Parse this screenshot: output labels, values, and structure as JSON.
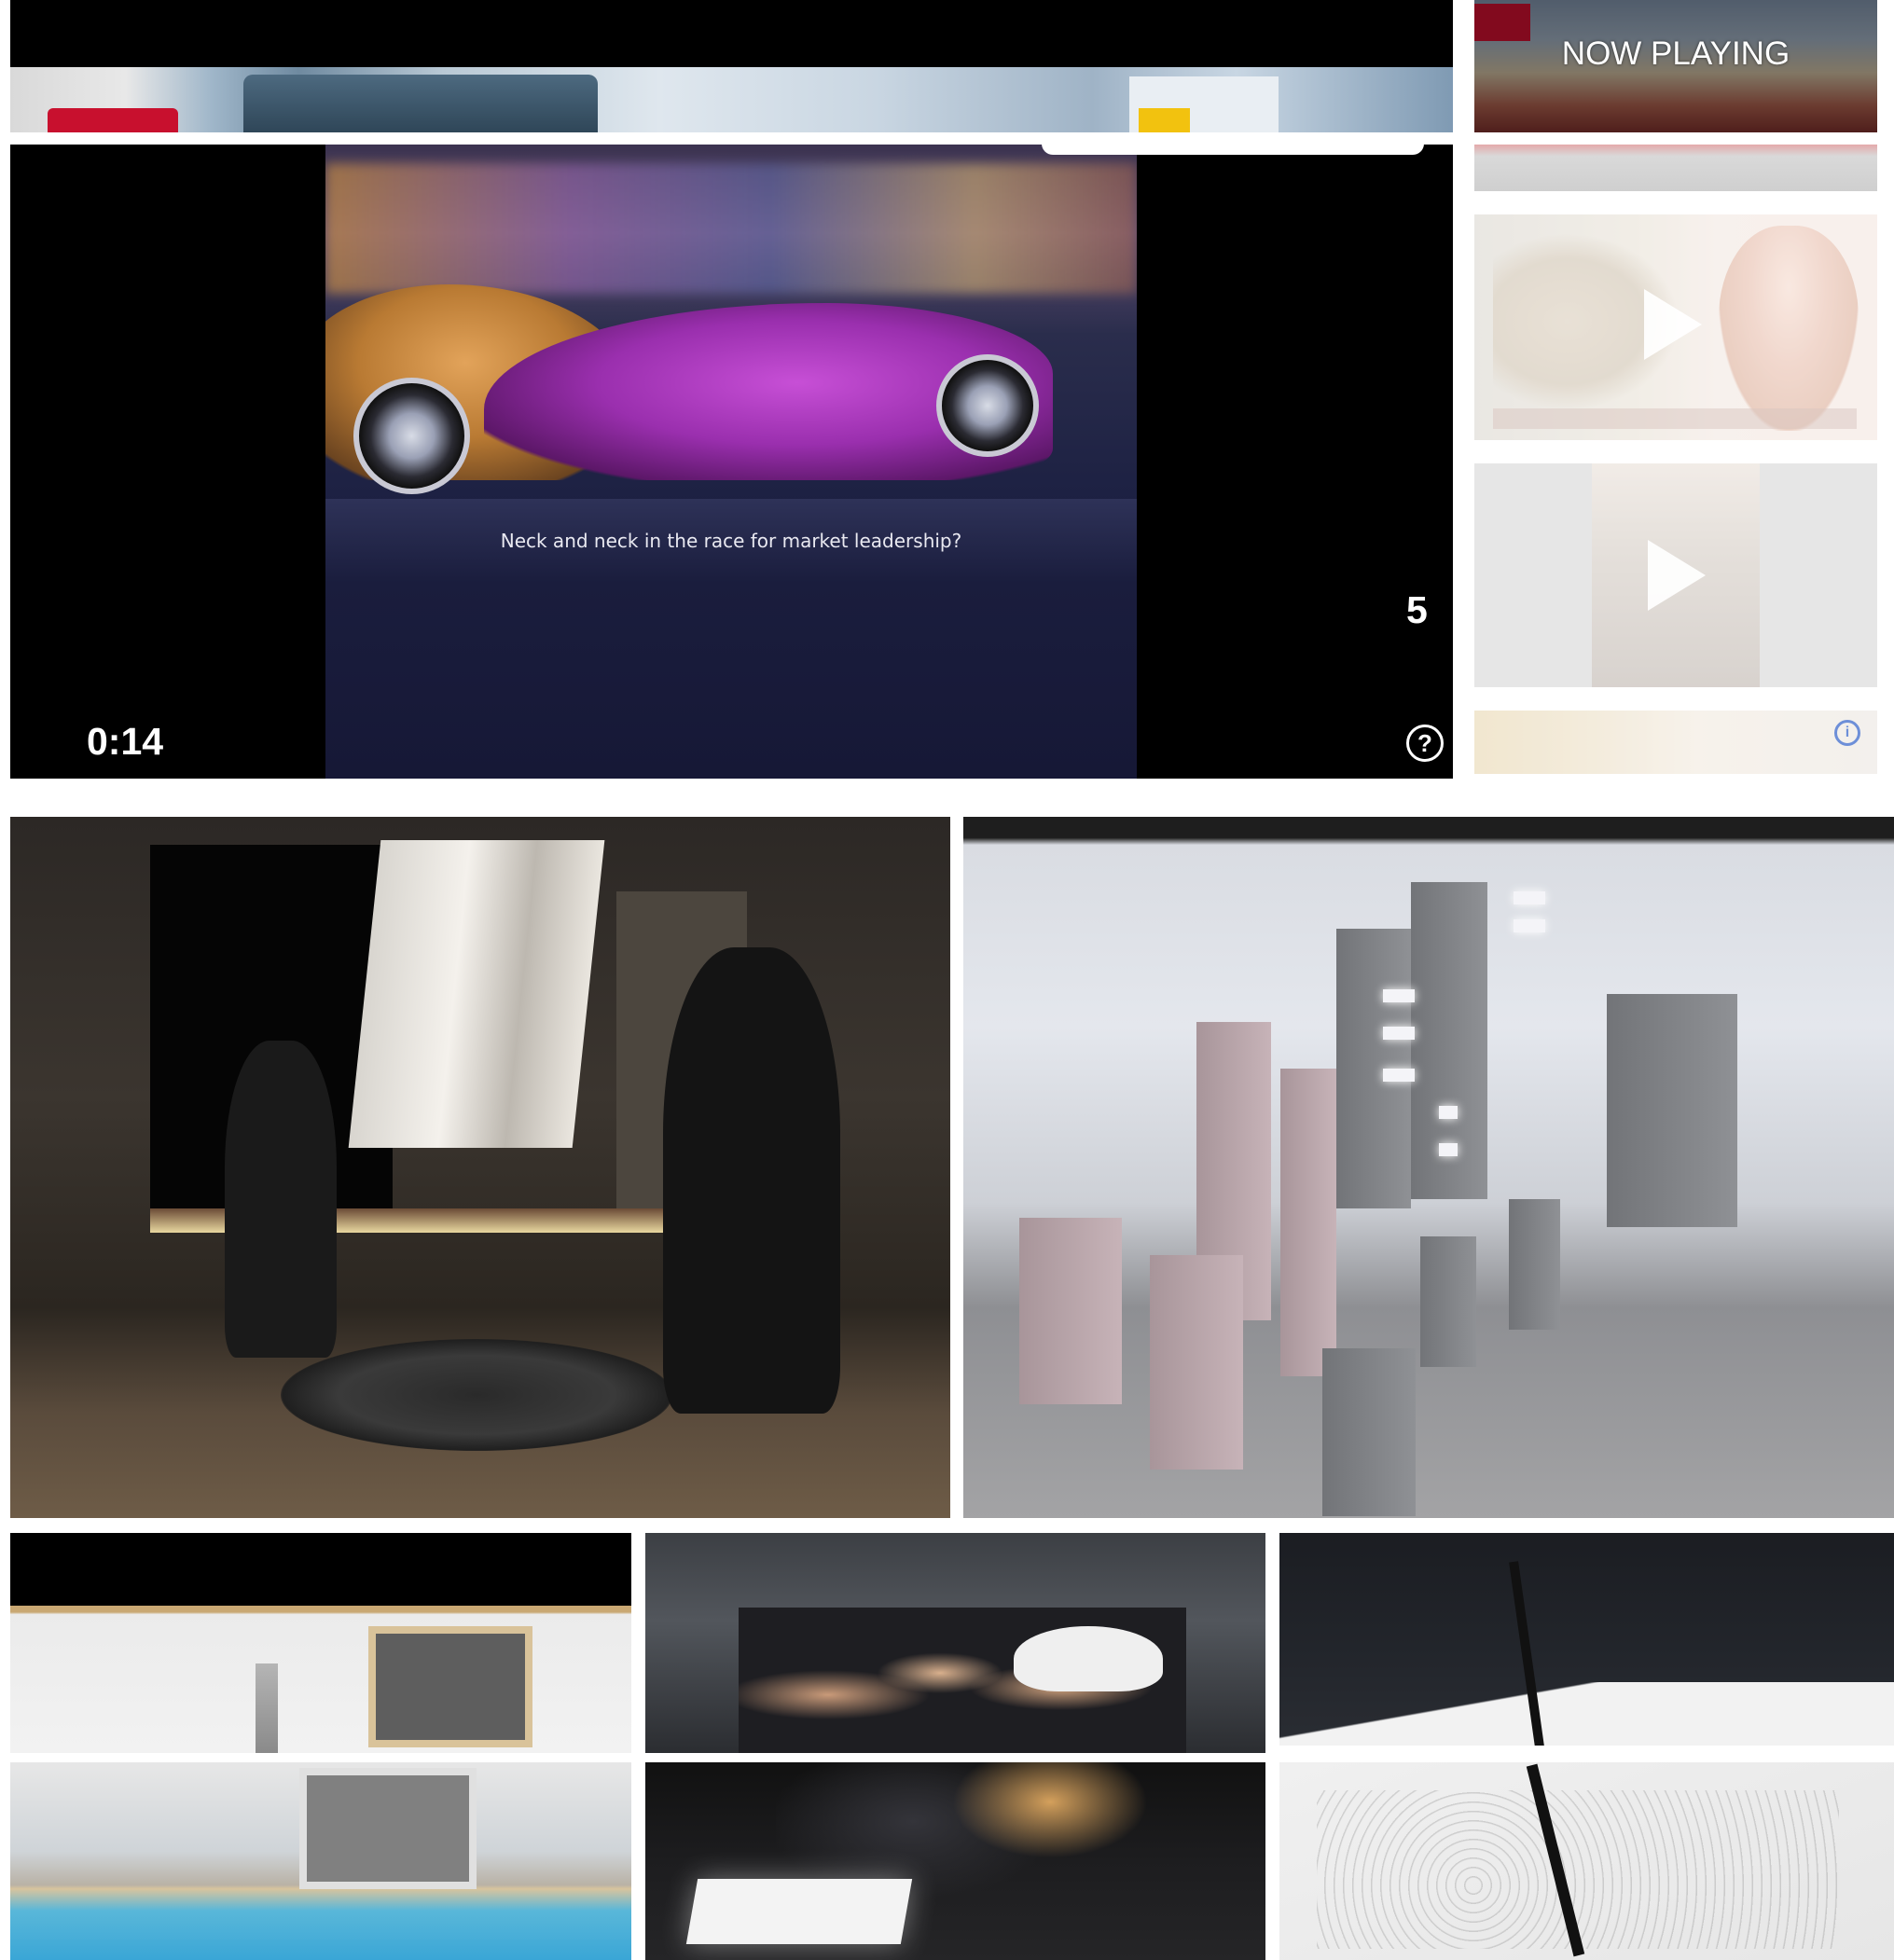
{
  "video_player": {
    "caption": "Neck and neck in the race for market leadership?",
    "elapsed_time": "0:14",
    "skip_countdown": "5",
    "help_icon_glyph": "?",
    "help_icon": "question-circle-icon"
  },
  "sidebar": {
    "now_playing_label": "NOW PLAYING",
    "play_icon": "play-triangle-icon",
    "ad_info_icon": "ad-choices-icon",
    "ad_info_glyph": "i"
  },
  "colors": {
    "player_background": "#000000",
    "page_background": "#ffffff",
    "ad_info_accent": "#6d8fd8"
  }
}
